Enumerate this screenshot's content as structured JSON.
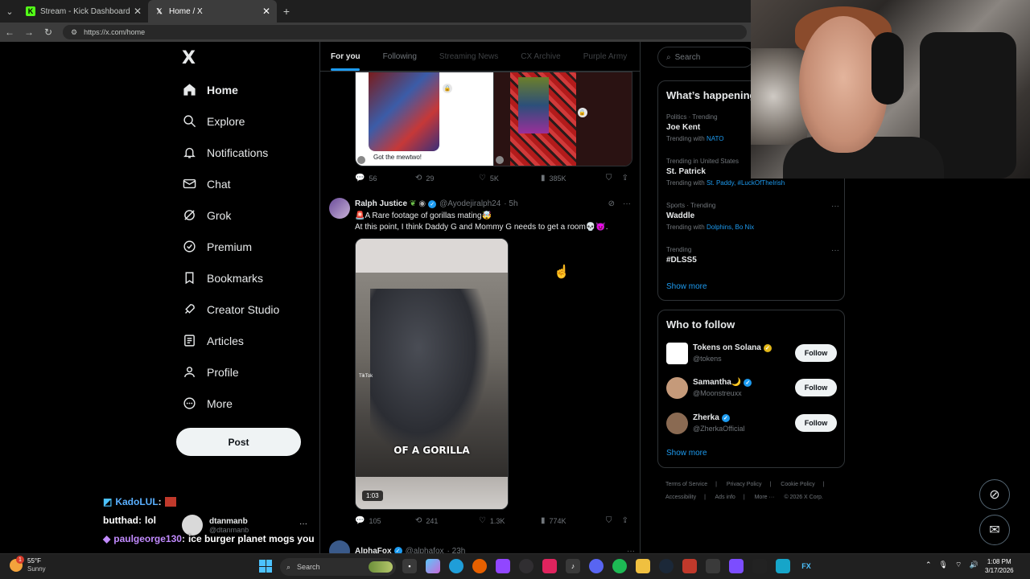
{
  "browser": {
    "tabs": [
      {
        "label": "Stream - Kick Dashboard",
        "favicon": "kick-icon",
        "color": "#53fc18"
      },
      {
        "label": "Home / X",
        "favicon": "x-icon",
        "color": "#ffffff"
      }
    ],
    "url": "https://x.com/home"
  },
  "sidebar": {
    "logo": "X",
    "items": [
      {
        "label": "Home",
        "icon": "home-icon"
      },
      {
        "label": "Explore",
        "icon": "search-icon"
      },
      {
        "label": "Notifications",
        "icon": "bell-icon"
      },
      {
        "label": "Chat",
        "icon": "mail-icon"
      },
      {
        "label": "Grok",
        "icon": "grok-icon"
      },
      {
        "label": "Premium",
        "icon": "verified-icon"
      },
      {
        "label": "Bookmarks",
        "icon": "bookmark-icon"
      },
      {
        "label": "Creator Studio",
        "icon": "rocket-icon"
      },
      {
        "label": "Articles",
        "icon": "article-icon"
      },
      {
        "label": "Profile",
        "icon": "person-icon"
      },
      {
        "label": "More",
        "icon": "more-circle-icon"
      }
    ],
    "post_label": "Post",
    "account": {
      "name": "dtanmanb",
      "handle": "@dtanmanb",
      "more": "···"
    }
  },
  "chat_overlay": [
    {
      "user": "KadoLUL",
      "sep": " :",
      "message": "",
      "color": "#5ab0ff"
    },
    {
      "user": "butthad",
      "sep": " :",
      "message": "lol",
      "color": "#ffffff"
    },
    {
      "user": "paulgeorge130",
      "sep": " :",
      "message": "ice burger planet mogs you",
      "color": "#c28bff"
    }
  ],
  "timeline": {
    "tabs": [
      "For you",
      "Following",
      "Streaming News",
      "CX Archive",
      "Purple Army"
    ],
    "active_tab": "For you",
    "tweet1": {
      "caption": "Got the mewtwo!",
      "replies": "56",
      "reposts": "29",
      "likes": "5K",
      "views": "385K"
    },
    "tweet2": {
      "name": "Ralph Justice",
      "handle": "@Ayodejiralph24",
      "time": "· 5h",
      "text_line1": "🚨A Rare footage of gorillas mating🤯",
      "text_line2": "At this point, I think Daddy G and Mommy G needs to get a room💀😈.",
      "video_caption": "OF A GORILLA",
      "tiktok": "TikTok",
      "duration": "1:03",
      "replies": "105",
      "reposts": "241",
      "likes": "1.3K",
      "views": "774K"
    },
    "tweet3": {
      "name": "AlphaFox",
      "handle": "@alphafox",
      "time": "· 23h"
    }
  },
  "right": {
    "search_placeholder": "Search",
    "trends_title": "What’s happening",
    "trends": [
      {
        "meta": "Politics · Trending",
        "title": "Joe Kent",
        "with_label": "Trending with",
        "with": "NATO"
      },
      {
        "meta": "Trending in United States",
        "title": "St. Patrick",
        "with_label": "Trending with",
        "with": "St. Paddy, #LuckOfTheIrish"
      },
      {
        "meta": "Sports · Trending",
        "title": "Waddle",
        "with_label": "Trending with",
        "with": "Dolphins, Bo Nix"
      },
      {
        "meta": "Trending",
        "title": "#DLSS5",
        "with_label": "",
        "with": ""
      }
    ],
    "show_more": "Show more",
    "wtf_title": "Who to follow",
    "follow": [
      {
        "name": "Tokens on Solana",
        "handle": "@tokens",
        "button": "Follow"
      },
      {
        "name": "Samantha🌙",
        "handle": "@Moonstreuxx",
        "button": "Follow"
      },
      {
        "name": "Zherka",
        "handle": "@ZherkaOfficial",
        "button": "Follow"
      }
    ],
    "footer": [
      "Terms of Service",
      "|",
      "Privacy Policy",
      "|",
      "Cookie Policy",
      "|",
      "Accessibility",
      "|",
      "Ads info",
      "|",
      "More ···",
      "© 2026 X Corp."
    ]
  },
  "taskbar": {
    "temp": "55°F",
    "condition": "Sunny",
    "notif_count": "1",
    "search_label": "Search",
    "time": "1:08 PM",
    "date": "3/17/2026"
  }
}
